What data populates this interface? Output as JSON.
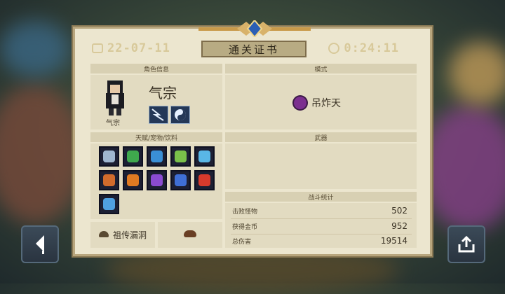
{
  "header": {
    "date": "22-07-11",
    "title": "通关证书",
    "time": "0:24:11"
  },
  "character": {
    "section_label": "角色信息",
    "name": "气宗",
    "caption": "气宗",
    "skills": [
      "lightning-skill-icon",
      "yin-yang-skill-icon"
    ]
  },
  "mode": {
    "section_label": "模式",
    "icon": "demon-icon",
    "value": "吊炸天"
  },
  "talents": {
    "section_label": "天赋/宠物/饮料",
    "items": [
      {
        "icon": "shield-icon",
        "color": "#9fb6cf"
      },
      {
        "icon": "green-shield-icon",
        "color": "#3fa84d"
      },
      {
        "icon": "arrow-icon",
        "color": "#3a8fd6"
      },
      {
        "icon": "bow-icon",
        "color": "#7ac04a"
      },
      {
        "icon": "ice-blade-icon",
        "color": "#59b7e6"
      },
      {
        "icon": "potion-icon",
        "color": "#d16b2c"
      },
      {
        "icon": "fire-shield-icon",
        "color": "#e07a22"
      },
      {
        "icon": "purple-shield-icon",
        "color": "#8a4bd1"
      },
      {
        "icon": "blue-shield-icon",
        "color": "#3f6fd6"
      },
      {
        "icon": "health-cross-icon",
        "color": "#d83a2c"
      },
      {
        "icon": "brain-icon",
        "color": "#4fa0e0"
      }
    ]
  },
  "weapon": {
    "section_label": "武器"
  },
  "stats": {
    "section_label": "战斗统计",
    "rows": [
      {
        "label": "击败怪物",
        "value": "502"
      },
      {
        "label": "获得金币",
        "value": "952"
      },
      {
        "label": "总伤害",
        "value": "19514"
      }
    ]
  },
  "relic": {
    "label": "祖传漏洞",
    "pet_icon": "turtle-icon",
    "item_icon": "teapot-icon"
  },
  "buttons": {
    "back_icon": "back-arrow-icon",
    "share_icon": "share-icon"
  }
}
